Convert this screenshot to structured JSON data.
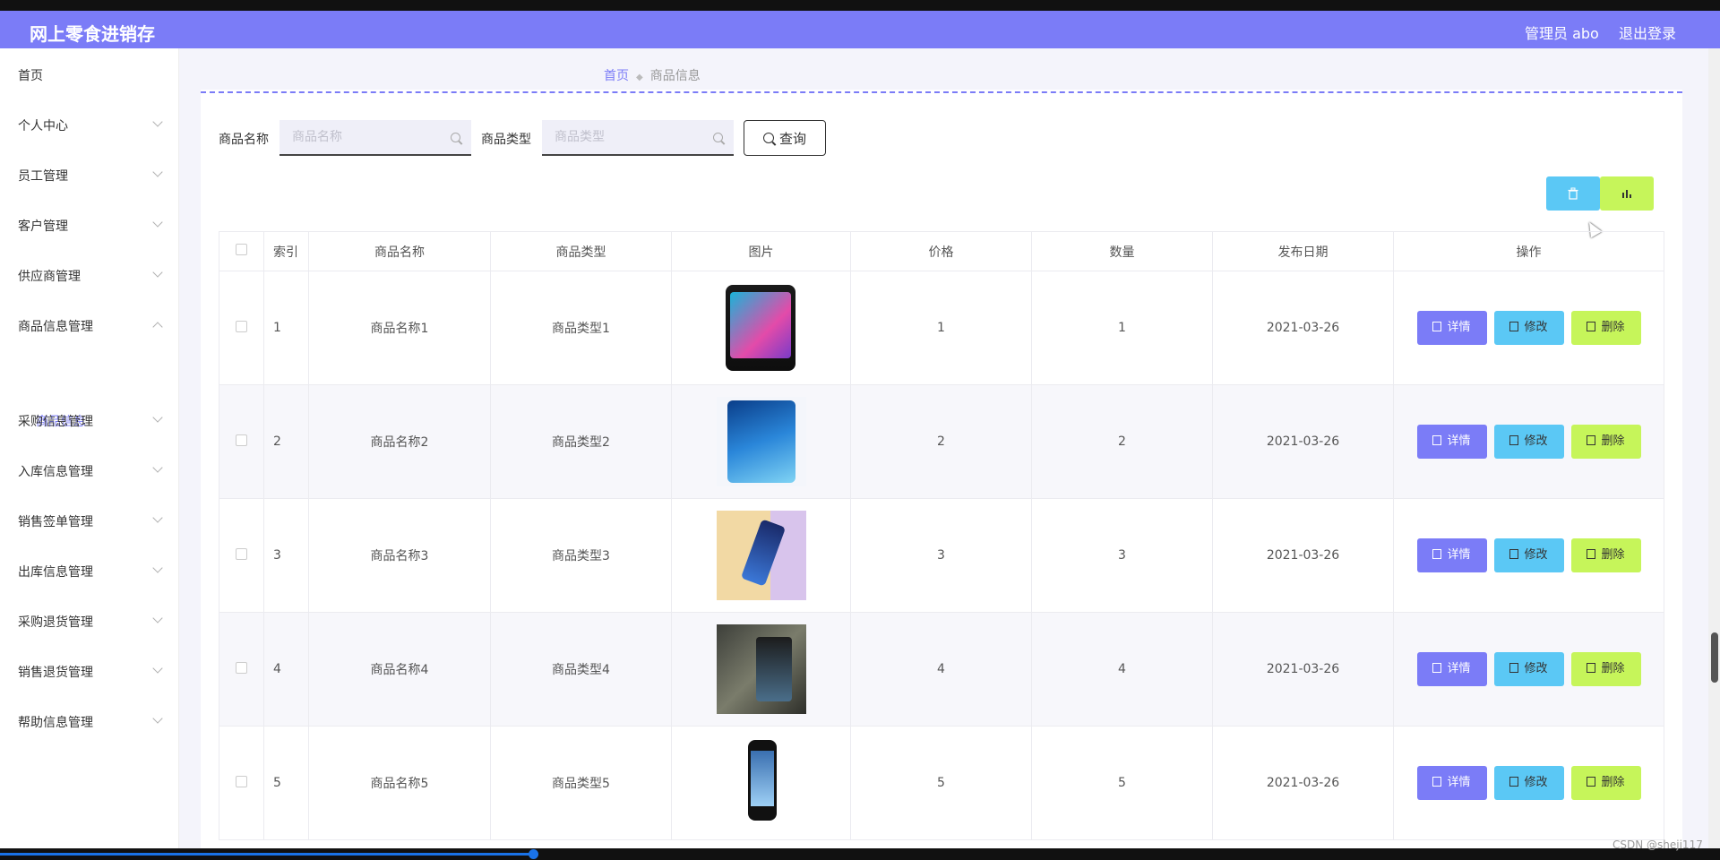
{
  "app": {
    "title": "网上零食进销存",
    "user": "管理员 abo",
    "logout": "退出登录"
  },
  "sidebar": {
    "items": [
      {
        "label": "首页"
      },
      {
        "label": "个人中心"
      },
      {
        "label": "员工管理"
      },
      {
        "label": "客户管理"
      },
      {
        "label": "供应商管理"
      },
      {
        "label": "商品信息管理"
      },
      {
        "label": "采购信息管理"
      },
      {
        "label": "入库信息管理"
      },
      {
        "label": "销售签单管理"
      },
      {
        "label": "出库信息管理"
      },
      {
        "label": "采购退货管理"
      },
      {
        "label": "销售退货管理"
      },
      {
        "label": "帮助信息管理"
      }
    ],
    "sub_item": "商品信息"
  },
  "breadcrumb": {
    "home": "首页",
    "current": "商品信息"
  },
  "search": {
    "name_label": "商品名称",
    "name_placeholder": "商品名称",
    "type_label": "商品类型",
    "type_placeholder": "商品类型",
    "query": "查询"
  },
  "table": {
    "headers": [
      "索引",
      "商品名称",
      "商品类型",
      "图片",
      "价格",
      "数量",
      "发布日期",
      "操作"
    ],
    "rows": [
      {
        "idx": "1",
        "name": "商品名称1",
        "type": "商品类型1",
        "price": "1",
        "qty": "1",
        "date": "2021-03-26"
      },
      {
        "idx": "2",
        "name": "商品名称2",
        "type": "商品类型2",
        "price": "2",
        "qty": "2",
        "date": "2021-03-26"
      },
      {
        "idx": "3",
        "name": "商品名称3",
        "type": "商品类型3",
        "price": "3",
        "qty": "3",
        "date": "2021-03-26"
      },
      {
        "idx": "4",
        "name": "商品名称4",
        "type": "商品类型4",
        "price": "4",
        "qty": "4",
        "date": "2021-03-26"
      },
      {
        "idx": "5",
        "name": "商品名称5",
        "type": "商品类型5",
        "price": "5",
        "qty": "5",
        "date": "2021-03-26"
      }
    ],
    "actions": {
      "detail": "详情",
      "edit": "修改",
      "delete": "删除"
    }
  },
  "watermark": "CSDN @sheji117",
  "colors": {
    "primary": "#7b7cf7",
    "info": "#5bc8f5",
    "lime": "#c6f55a"
  }
}
